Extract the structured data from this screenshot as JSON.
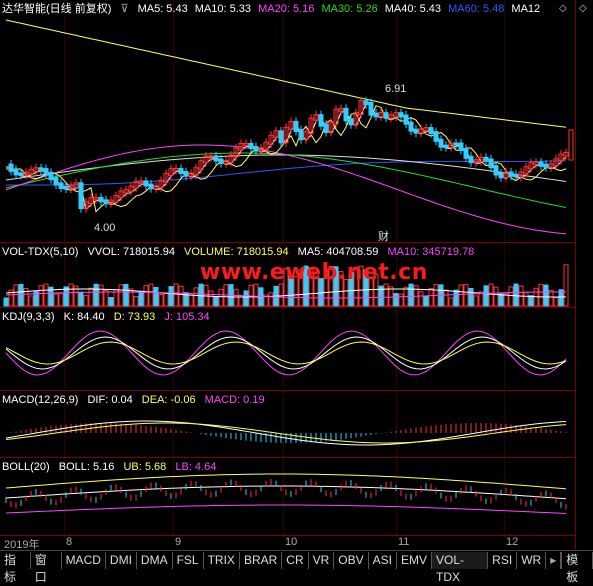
{
  "main": {
    "title": "达华智能(日线 前复权)",
    "ma": [
      {
        "label": "MA5: 5.43",
        "color": "#ffffff"
      },
      {
        "label": "MA10: 5.33",
        "color": "#ffffff"
      },
      {
        "label": "MA20: 5.16",
        "color": "#ff44ff"
      },
      {
        "label": "MA30: 5.26",
        "color": "#22dd22"
      },
      {
        "label": "MA40: 5.43",
        "color": "#ffffff"
      },
      {
        "label": "MA60: 5.48",
        "color": "#3355ff"
      },
      {
        "label": "MA12",
        "color": "#ffffff"
      }
    ],
    "high_label": "6.91",
    "low_label": "4.00",
    "cai_label": "财"
  },
  "vol": {
    "title": "VOL-TDX(5,10)",
    "vvol": "VVOL: 718015.94",
    "volume": "VOLUME: 718015.94",
    "ma5": "MA5: 404708.59",
    "ma10": "MA10: 345719.78"
  },
  "watermark": "www.eweb.net.cn",
  "kdj": {
    "title": "KDJ(9,3,3)",
    "k": "K: 84.40",
    "d": "D: 73.93",
    "j": "J: 105.34"
  },
  "macd": {
    "title": "MACD(12,26,9)",
    "dif": "DIF: 0.04",
    "dea": "DEA: -0.06",
    "macd": "MACD: 0.19"
  },
  "boll": {
    "title": "BOLL(20)",
    "boll": "BOLL: 5.16",
    "ub": "UB: 5.68",
    "lb": "LB: 4.64"
  },
  "dates": {
    "year": "2019年",
    "m8": "8",
    "m9": "9",
    "m10": "10",
    "m11": "11",
    "m12": "12"
  },
  "tabs": [
    "指标",
    "窗口",
    "MACD",
    "DMI",
    "DMA",
    "FSL",
    "TRIX",
    "BRAR",
    "CR",
    "VR",
    "OBV",
    "ASI",
    "EMV",
    "VOL-TDX",
    "RSI",
    "WR"
  ],
  "tab_right": "模板",
  "colors": {
    "up": "#ff3333",
    "down": "#33ccff",
    "grid": "#7a0000"
  }
}
